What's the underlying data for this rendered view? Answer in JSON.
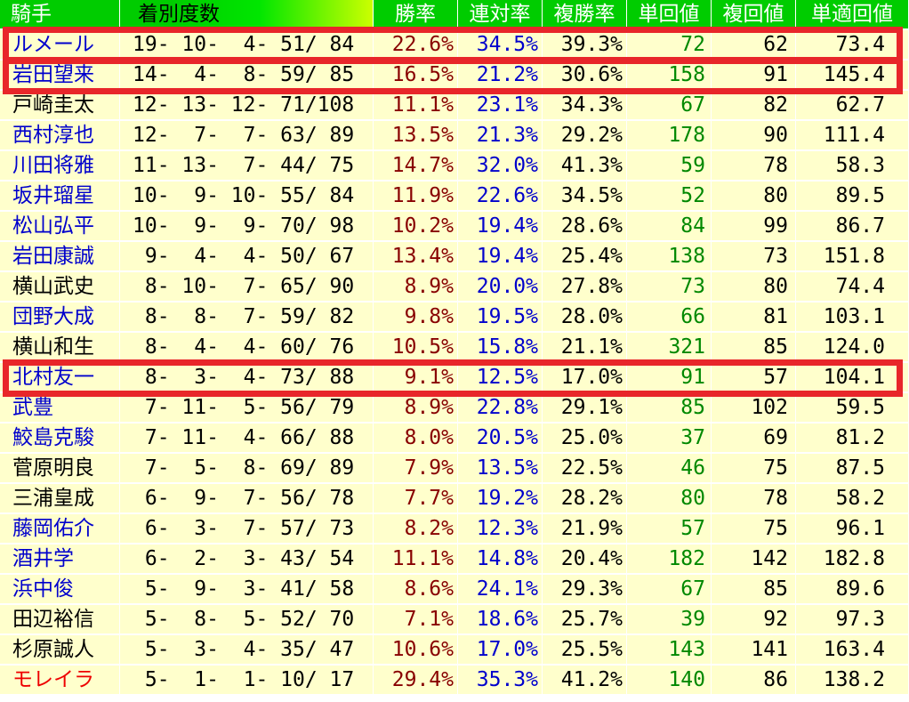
{
  "colors": {
    "header_bg": "#00cc00",
    "row_bg": "#ffffcc",
    "win_rate": "#880000",
    "top2_rate": "#0000cc",
    "win_return": "#008800",
    "highlight": "#e8262a"
  },
  "headers": [
    "騎手",
    "着別度数",
    "勝率",
    "連対率",
    "複勝率",
    "単回値",
    "複回値",
    "単適回値"
  ],
  "rows": [
    {
      "jockey": "ルメール",
      "jockey_color": "#0000cc",
      "record": "19- 10-  4- 51/ 84",
      "win": "22.6%",
      "top2": "34.5%",
      "top3": "39.3%",
      "win_ret": "72",
      "place_ret": "62",
      "adj_ret": "73.4"
    },
    {
      "jockey": "岩田望来",
      "jockey_color": "#0000cc",
      "record": "14-  4-  8- 59/ 85",
      "win": "16.5%",
      "top2": "21.2%",
      "top3": "30.6%",
      "win_ret": "158",
      "place_ret": "91",
      "adj_ret": "145.4"
    },
    {
      "jockey": "戸崎圭太",
      "jockey_color": "#000000",
      "record": "12- 13- 12- 71/108",
      "win": "11.1%",
      "top2": "23.1%",
      "top3": "34.3%",
      "win_ret": "67",
      "place_ret": "82",
      "adj_ret": "62.7"
    },
    {
      "jockey": "西村淳也",
      "jockey_color": "#0000cc",
      "record": "12-  7-  7- 63/ 89",
      "win": "13.5%",
      "top2": "21.3%",
      "top3": "29.2%",
      "win_ret": "178",
      "place_ret": "90",
      "adj_ret": "111.4"
    },
    {
      "jockey": "川田将雅",
      "jockey_color": "#0000cc",
      "record": "11- 13-  7- 44/ 75",
      "win": "14.7%",
      "top2": "32.0%",
      "top3": "41.3%",
      "win_ret": "59",
      "place_ret": "78",
      "adj_ret": "58.3"
    },
    {
      "jockey": "坂井瑠星",
      "jockey_color": "#0000cc",
      "record": "10-  9- 10- 55/ 84",
      "win": "11.9%",
      "top2": "22.6%",
      "top3": "34.5%",
      "win_ret": "52",
      "place_ret": "80",
      "adj_ret": "89.5"
    },
    {
      "jockey": "松山弘平",
      "jockey_color": "#0000cc",
      "record": "10-  9-  9- 70/ 98",
      "win": "10.2%",
      "top2": "19.4%",
      "top3": "28.6%",
      "win_ret": "84",
      "place_ret": "99",
      "adj_ret": "86.7"
    },
    {
      "jockey": "岩田康誠",
      "jockey_color": "#0000cc",
      "record": " 9-  4-  4- 50/ 67",
      "win": "13.4%",
      "top2": "19.4%",
      "top3": "25.4%",
      "win_ret": "138",
      "place_ret": "73",
      "adj_ret": "151.8"
    },
    {
      "jockey": "横山武史",
      "jockey_color": "#000000",
      "record": " 8- 10-  7- 65/ 90",
      "win": "8.9%",
      "top2": "20.0%",
      "top3": "27.8%",
      "win_ret": "73",
      "place_ret": "80",
      "adj_ret": "74.4"
    },
    {
      "jockey": "団野大成",
      "jockey_color": "#0000cc",
      "record": " 8-  8-  7- 59/ 82",
      "win": "9.8%",
      "top2": "19.5%",
      "top3": "28.0%",
      "win_ret": "66",
      "place_ret": "81",
      "adj_ret": "103.1"
    },
    {
      "jockey": "横山和生",
      "jockey_color": "#000000",
      "record": " 8-  4-  4- 60/ 76",
      "win": "10.5%",
      "top2": "15.8%",
      "top3": "21.1%",
      "win_ret": "321",
      "place_ret": "85",
      "adj_ret": "124.0"
    },
    {
      "jockey": "北村友一",
      "jockey_color": "#0000cc",
      "record": " 8-  3-  4- 73/ 88",
      "win": "9.1%",
      "top2": "12.5%",
      "top3": "17.0%",
      "win_ret": "91",
      "place_ret": "57",
      "adj_ret": "104.1"
    },
    {
      "jockey": "武豊",
      "jockey_color": "#0000cc",
      "record": " 7- 11-  5- 56/ 79",
      "win": "8.9%",
      "top2": "22.8%",
      "top3": "29.1%",
      "win_ret": "85",
      "place_ret": "102",
      "adj_ret": "59.5"
    },
    {
      "jockey": "鮫島克駿",
      "jockey_color": "#0000cc",
      "record": " 7- 11-  4- 66/ 88",
      "win": "8.0%",
      "top2": "20.5%",
      "top3": "25.0%",
      "win_ret": "37",
      "place_ret": "69",
      "adj_ret": "81.2"
    },
    {
      "jockey": "菅原明良",
      "jockey_color": "#000000",
      "record": " 7-  5-  8- 69/ 89",
      "win": "7.9%",
      "top2": "13.5%",
      "top3": "22.5%",
      "win_ret": "46",
      "place_ret": "75",
      "adj_ret": "87.5"
    },
    {
      "jockey": "三浦皇成",
      "jockey_color": "#000000",
      "record": " 6-  9-  7- 56/ 78",
      "win": "7.7%",
      "top2": "19.2%",
      "top3": "28.2%",
      "win_ret": "80",
      "place_ret": "78",
      "adj_ret": "58.2"
    },
    {
      "jockey": "藤岡佑介",
      "jockey_color": "#0000cc",
      "record": " 6-  3-  7- 57/ 73",
      "win": "8.2%",
      "top2": "12.3%",
      "top3": "21.9%",
      "win_ret": "57",
      "place_ret": "75",
      "adj_ret": "96.1"
    },
    {
      "jockey": "酒井学",
      "jockey_color": "#0000cc",
      "record": " 6-  2-  3- 43/ 54",
      "win": "11.1%",
      "top2": "14.8%",
      "top3": "20.4%",
      "win_ret": "182",
      "place_ret": "142",
      "adj_ret": "182.8"
    },
    {
      "jockey": "浜中俊",
      "jockey_color": "#0000cc",
      "record": " 5-  9-  3- 41/ 58",
      "win": "8.6%",
      "top2": "24.1%",
      "top3": "29.3%",
      "win_ret": "67",
      "place_ret": "85",
      "adj_ret": "89.6"
    },
    {
      "jockey": "田辺裕信",
      "jockey_color": "#000000",
      "record": " 5-  8-  5- 52/ 70",
      "win": "7.1%",
      "top2": "18.6%",
      "top3": "25.7%",
      "win_ret": "39",
      "place_ret": "92",
      "adj_ret": "97.3"
    },
    {
      "jockey": "杉原誠人",
      "jockey_color": "#000000",
      "record": " 5-  3-  4- 35/ 47",
      "win": "10.6%",
      "top2": "17.0%",
      "top3": "25.5%",
      "win_ret": "143",
      "place_ret": "141",
      "adj_ret": "163.4"
    },
    {
      "jockey": "モレイラ",
      "jockey_color": "#ee0000",
      "record": " 5-  1-  1- 10/ 17",
      "win": "29.4%",
      "top2": "35.3%",
      "top3": "41.2%",
      "win_ret": "140",
      "place_ret": "86",
      "adj_ret": "138.2"
    }
  ],
  "highlighted_rows": [
    0,
    1,
    11
  ]
}
